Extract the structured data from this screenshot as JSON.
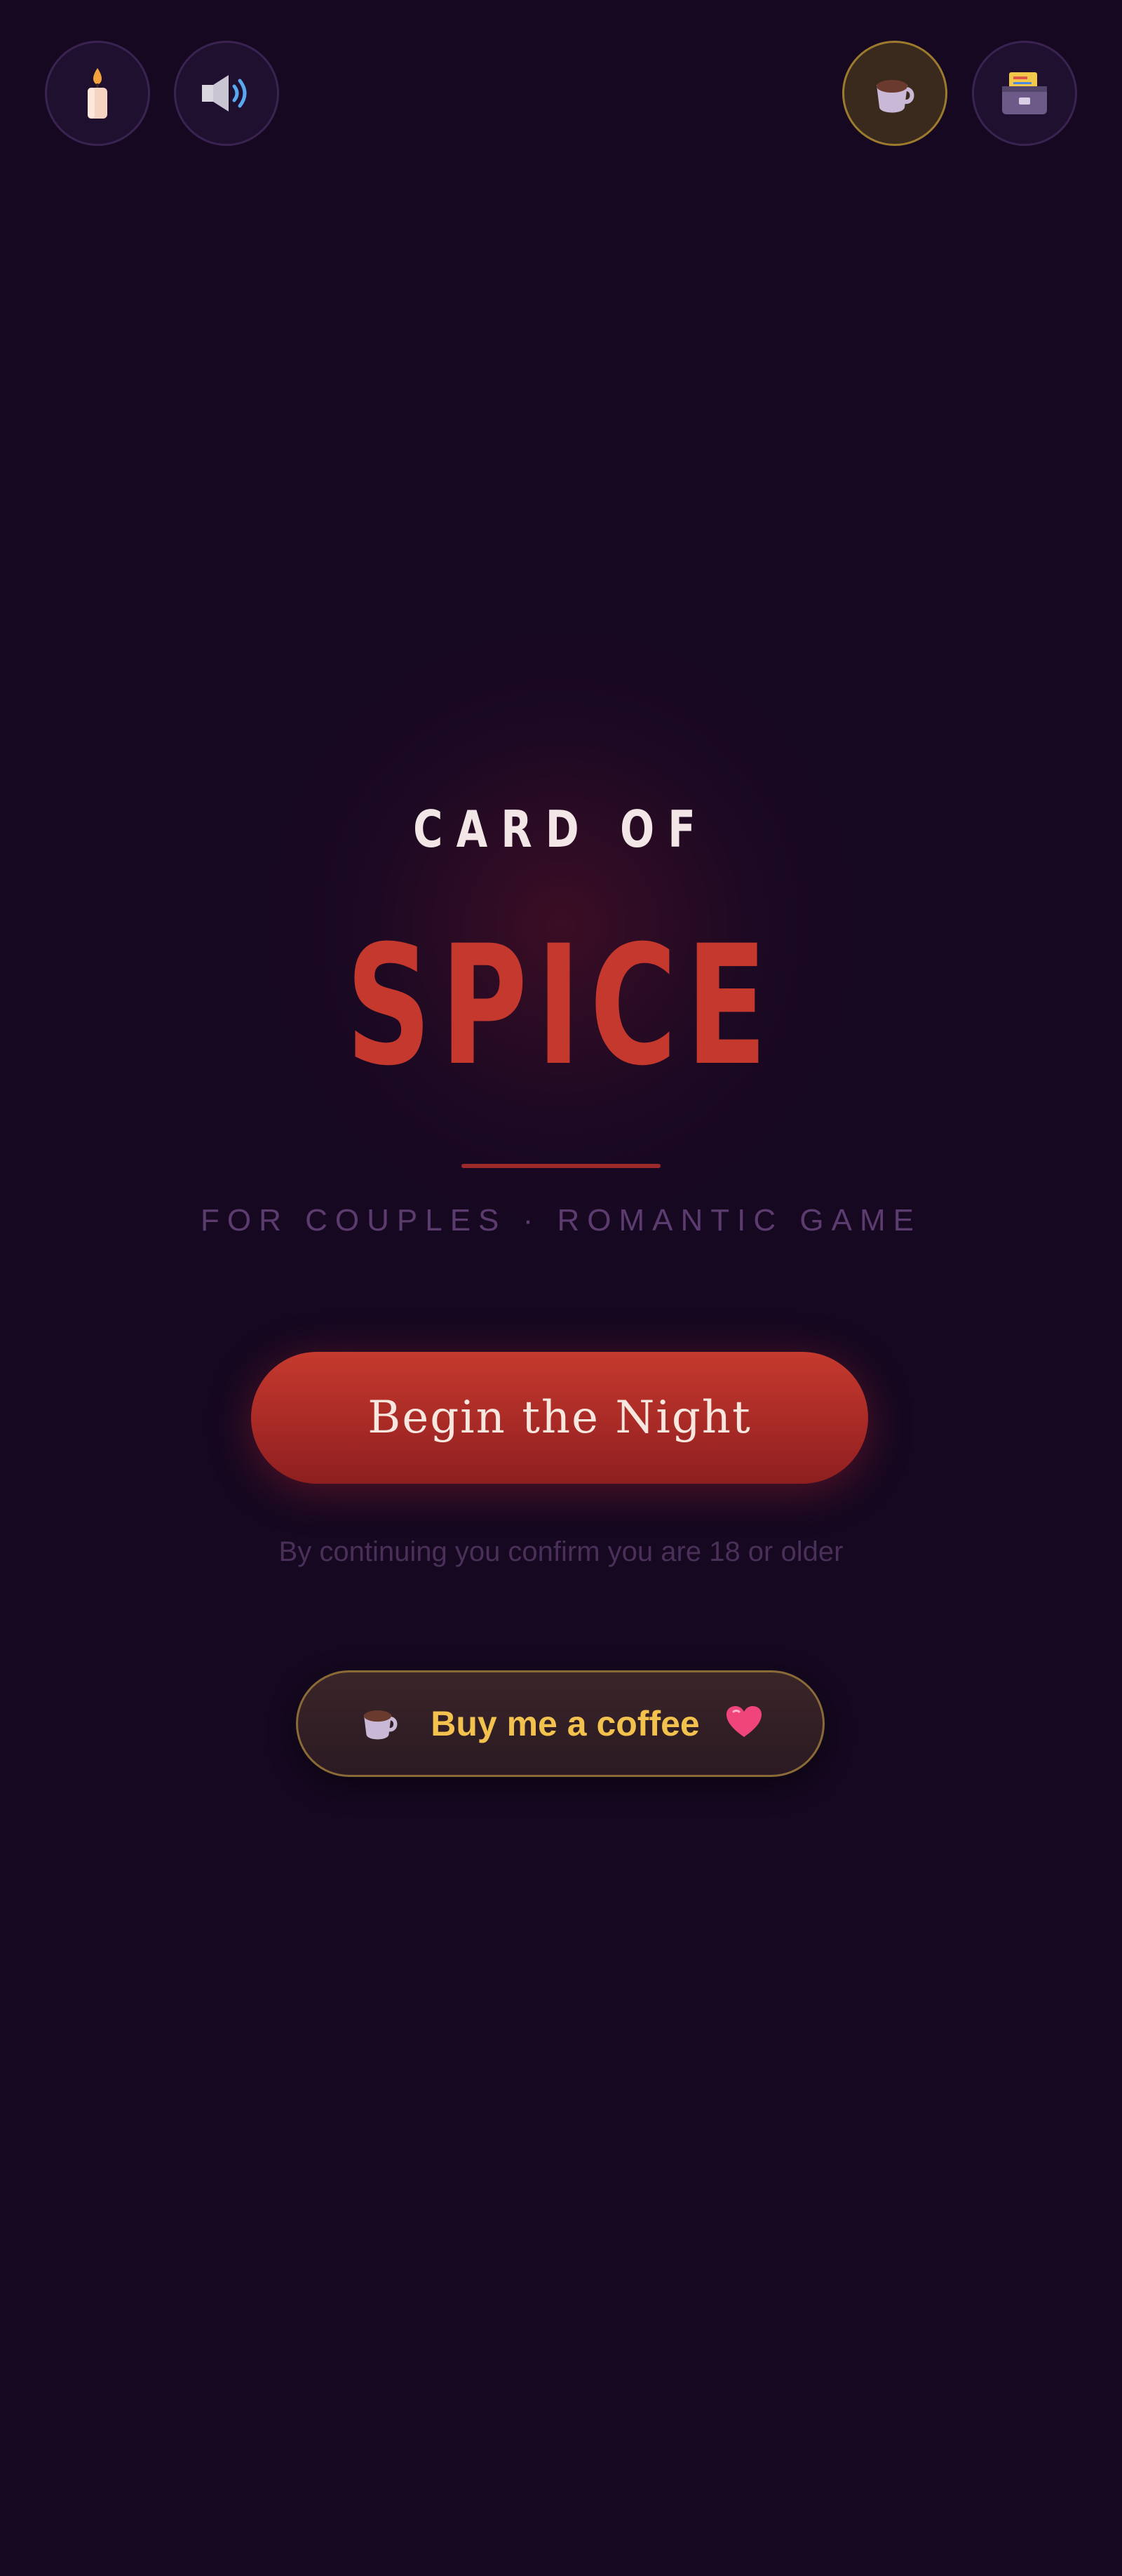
{
  "header": {
    "left_buttons": [
      {
        "icon": "candle-icon"
      },
      {
        "icon": "speaker-icon"
      }
    ],
    "right_buttons": [
      {
        "icon": "coffee-cup-icon"
      },
      {
        "icon": "card-file-box-icon"
      }
    ]
  },
  "hero": {
    "title_top": "CARD OF",
    "title_main": "SPICE",
    "subtitle": "FOR COUPLES · ROMANTIC GAME"
  },
  "actions": {
    "begin_label": "Begin the Night",
    "age_notice": "By continuing you confirm you are 18 or older",
    "coffee_label": "Buy me a coffee"
  },
  "colors": {
    "background": "#150820",
    "accent_red": "#c4382e",
    "gold": "#f2c14e",
    "subtitle_purple": "#5c3b6e"
  }
}
